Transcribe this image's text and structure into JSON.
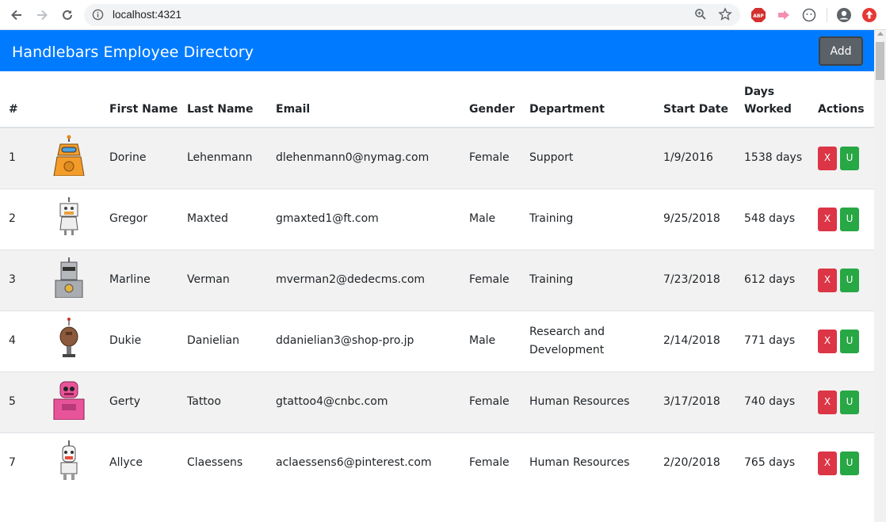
{
  "browser": {
    "url": "localhost:4321"
  },
  "app": {
    "title": "Handlebars Employee Directory",
    "add_label": "Add"
  },
  "table": {
    "headers": [
      "#",
      "",
      "First Name",
      "Last Name",
      "Email",
      "Gender",
      "Department",
      "Start Date",
      "Days Worked",
      "Actions"
    ],
    "delete_label": "X",
    "update_label": "U",
    "rows": [
      {
        "id": "1",
        "avatar": "orange-robot",
        "first": "Dorine",
        "last": "Lehenmann",
        "email": "dlehenmann0@nymag.com",
        "gender": "Female",
        "department": "Support",
        "start": "1/9/2016",
        "days": "1538 days"
      },
      {
        "id": "2",
        "avatar": "white-robot",
        "first": "Gregor",
        "last": "Maxted",
        "email": "gmaxted1@ft.com",
        "gender": "Male",
        "department": "Training",
        "start": "9/25/2018",
        "days": "548 days"
      },
      {
        "id": "3",
        "avatar": "grey-robot",
        "first": "Marline",
        "last": "Verman",
        "email": "mverman2@dedecms.com",
        "gender": "Female",
        "department": "Training",
        "start": "7/23/2018",
        "days": "612 days"
      },
      {
        "id": "4",
        "avatar": "brown-robot",
        "first": "Dukie",
        "last": "Danielian",
        "email": "ddanielian3@shop-pro.jp",
        "gender": "Male",
        "department": "Research and Development",
        "start": "2/14/2018",
        "days": "771 days"
      },
      {
        "id": "5",
        "avatar": "pink-robot",
        "first": "Gerty",
        "last": "Tattoo",
        "email": "gtattoo4@cnbc.com",
        "gender": "Female",
        "department": "Human Resources",
        "start": "3/17/2018",
        "days": "740 days"
      },
      {
        "id": "7",
        "avatar": "white-robot-2",
        "first": "Allyce",
        "last": "Claessens",
        "email": "aclaessens6@pinterest.com",
        "gender": "Female",
        "department": "Human Resources",
        "start": "2/20/2018",
        "days": "765 days"
      }
    ]
  },
  "colors": {
    "header_bg": "#007bff",
    "delete": "#dc3545",
    "update": "#28a745",
    "add": "#5a6268"
  }
}
